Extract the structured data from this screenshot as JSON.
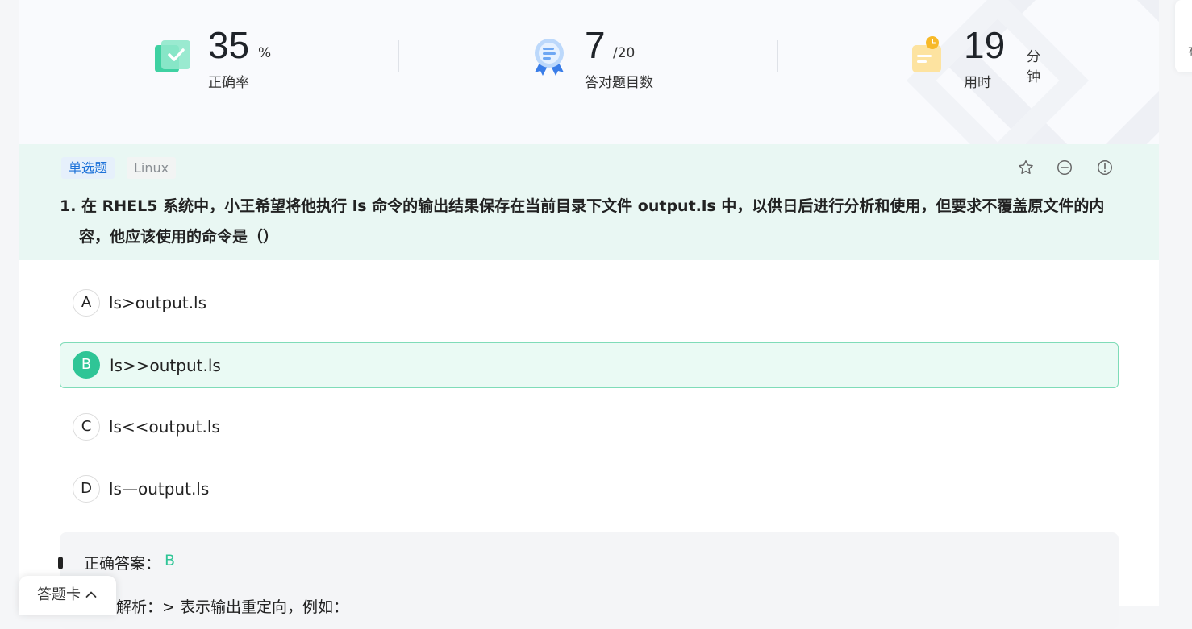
{
  "stats": {
    "accuracy": {
      "value": "35",
      "unit": "%",
      "label": "正确率"
    },
    "correct": {
      "value": "7",
      "unit": "/20",
      "label": "答对题目数"
    },
    "time": {
      "value": "19",
      "unit": "分钟",
      "label": "用时"
    }
  },
  "question": {
    "type_tag": "单选题",
    "subject_tag": "Linux",
    "number": "1.",
    "text": "1. 在 RHEL5 系统中，小王希望将他执行 ls 命令的输出结果保存在当前目录下文件 output.ls 中，以供日后进行分析和使用，但要求不覆盖原文件的内容，他应该使用的命令是（）",
    "actions": [
      "star-icon",
      "minus-circle-icon",
      "info-circle-icon"
    ]
  },
  "options": [
    {
      "letter": "A",
      "text": "ls>output.ls",
      "selected": false
    },
    {
      "letter": "B",
      "text": "ls>>output.ls",
      "selected": true
    },
    {
      "letter": "C",
      "text": "ls<<output.ls",
      "selected": false
    },
    {
      "letter": "D",
      "text": "ls—output.ls",
      "selected": false
    }
  ],
  "answer": {
    "label": "正确答案：",
    "value": "B",
    "analysis": "解析：> 表示输出重定向，例如："
  },
  "answer_card": {
    "label": "答题卡"
  },
  "side_panel": {
    "label": "有"
  },
  "colors": {
    "accent": "#2fc596",
    "banner": "#e9f7f3",
    "type_tag": "#1d72d8"
  }
}
